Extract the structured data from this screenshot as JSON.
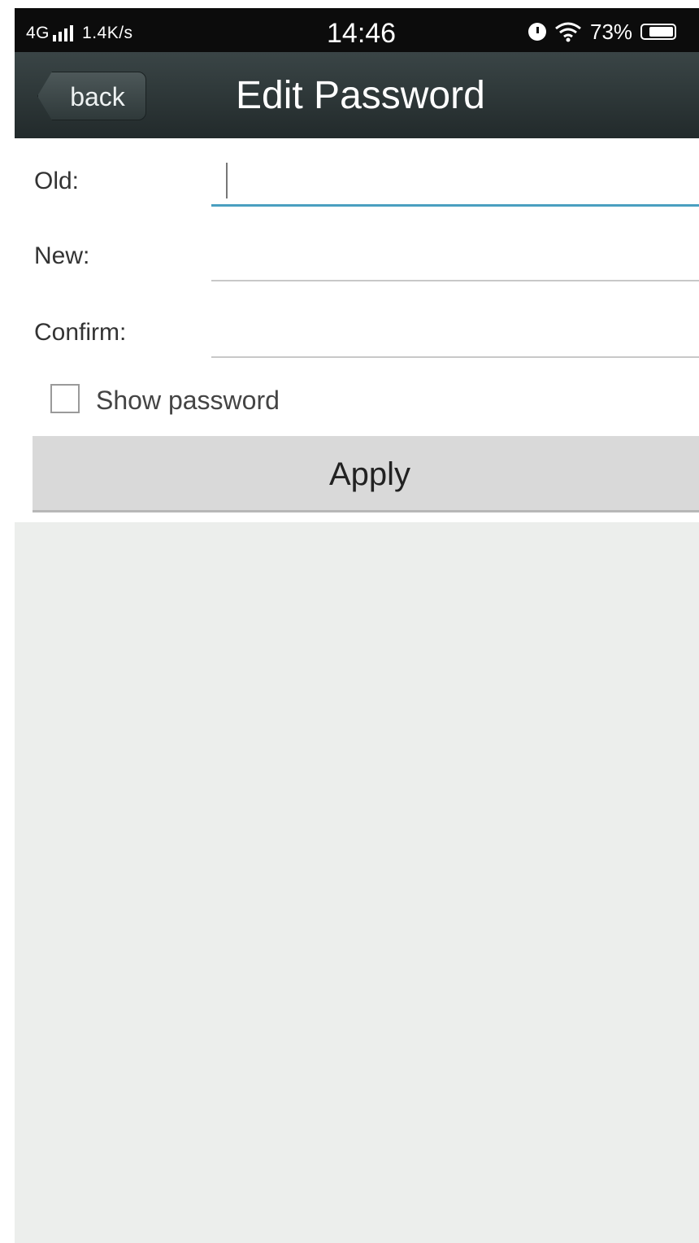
{
  "status_bar": {
    "network": "4G",
    "speed": "1.4K/s",
    "time": "14:46",
    "battery": "73%",
    "battery_level": 0.73,
    "icons": [
      "signal-icon",
      "alarm-icon",
      "wifi-icon",
      "battery-icon"
    ]
  },
  "header": {
    "back_label": "back",
    "title": "Edit Password"
  },
  "form": {
    "old_label": "Old:",
    "new_label": "New:",
    "confirm_label": "Confirm:",
    "old_value": "",
    "new_value": "",
    "confirm_value": "",
    "show_password_label": "Show password",
    "show_password_checked": false,
    "apply_label": "Apply"
  },
  "colors": {
    "header_dark": "#222a2b",
    "focus_underline": "#4a9fc0",
    "apply_bg": "#d9d9d9",
    "page_bg": "#eceeec"
  }
}
